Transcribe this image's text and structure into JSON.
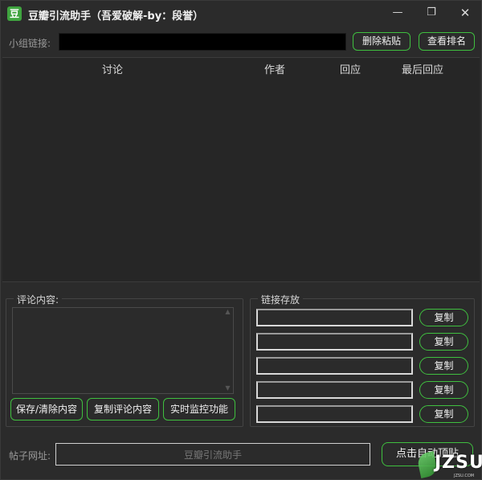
{
  "window": {
    "title": "豆瓣引流助手（吾爱破解-by：段誉）",
    "icon_glyph": "豆",
    "minimize_glyph": "—",
    "restore_glyph": "❐",
    "close_glyph": "✕"
  },
  "group_link": {
    "label": "小组链接:",
    "value": "",
    "delete_sticky_button": "删除粘贴",
    "view_ranking_button": "查看排名"
  },
  "table": {
    "columns": [
      "讨论",
      "作者",
      "回应",
      "最后回应"
    ],
    "rows": []
  },
  "comment_section": {
    "legend": "评论内容:",
    "content": "",
    "save_clear_button": "保存/清除内容",
    "copy_comment_button": "复制评论内容",
    "monitor_button": "实时监控功能"
  },
  "link_storage": {
    "legend": "链接存放",
    "slots": [
      {
        "value": "",
        "copy_label": "复制"
      },
      {
        "value": "",
        "copy_label": "复制"
      },
      {
        "value": "",
        "copy_label": "复制"
      },
      {
        "value": "",
        "copy_label": "复制"
      },
      {
        "value": "",
        "copy_label": "复制"
      }
    ]
  },
  "post_url": {
    "label": "帖子网址:",
    "value": "豆瓣引流助手",
    "auto_bump_button": "点击自动顶贴"
  },
  "watermark": {
    "text": "JZSU",
    "sub": "JZSU.COM"
  },
  "colors": {
    "background": "#2b2b2b",
    "accent_green": "#3fbf3f",
    "input_black": "#000000"
  }
}
